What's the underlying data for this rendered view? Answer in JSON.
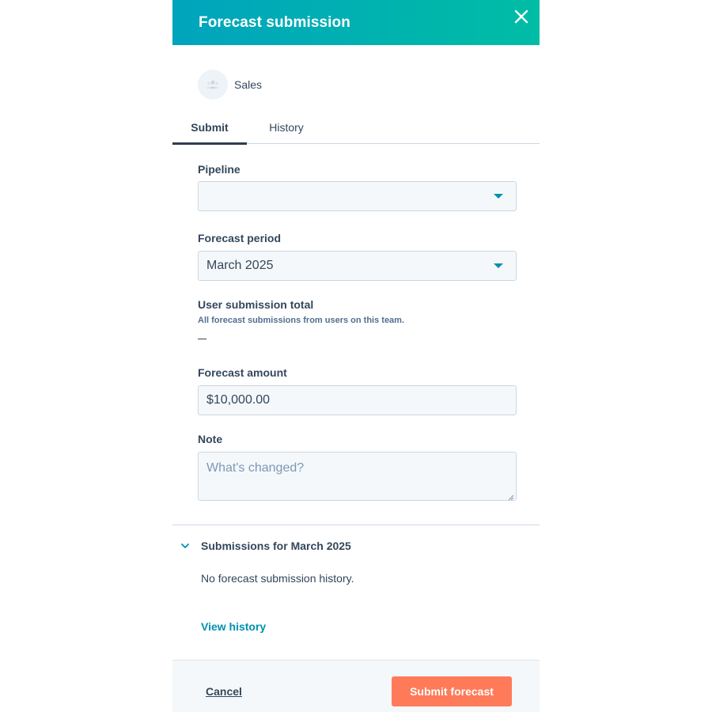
{
  "header": {
    "title": "Forecast submission",
    "close_icon": "close-icon"
  },
  "team": {
    "name": "Sales",
    "avatar_icon": "team-icon"
  },
  "tabs": [
    {
      "label": "Submit",
      "active": true
    },
    {
      "label": "History",
      "active": false
    }
  ],
  "form": {
    "pipeline": {
      "label": "Pipeline",
      "value": ""
    },
    "period": {
      "label": "Forecast period",
      "value": "March 2025"
    },
    "user_total": {
      "label": "User submission total",
      "help": "All forecast submissions from users on this team.",
      "value": "—"
    },
    "amount": {
      "label": "Forecast amount",
      "value": "$10,000.00"
    },
    "note": {
      "label": "Note",
      "placeholder": "What's changed?",
      "value": ""
    }
  },
  "submissions": {
    "title": "Submissions for March 2025",
    "expanded": true,
    "empty_text": "No forecast submission history.",
    "view_history_label": "View history"
  },
  "footer": {
    "cancel_label": "Cancel",
    "submit_label": "Submit forecast"
  },
  "colors": {
    "header_gradient_start": "#00a4bd",
    "header_gradient_end": "#00bda5",
    "primary_button": "#ff7a59",
    "link": "#0091ae",
    "text": "#33475b"
  }
}
